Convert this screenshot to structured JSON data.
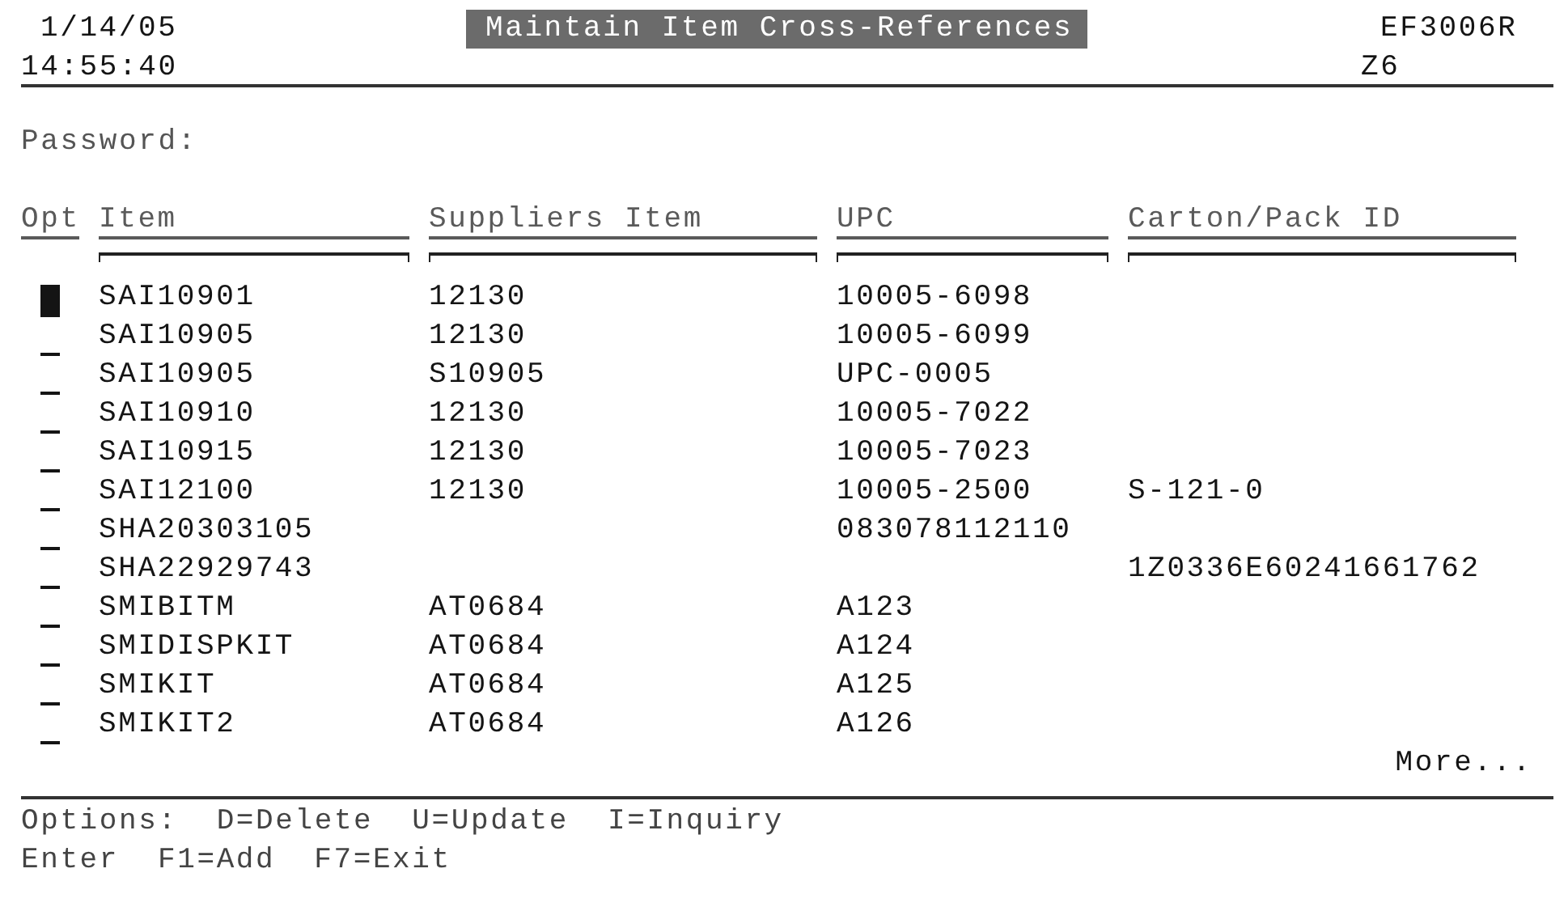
{
  "header": {
    "date": "1/14/05",
    "time": "14:55:40",
    "title": "Maintain Item Cross-References",
    "program": "EF3006R",
    "system": "Z6"
  },
  "password": {
    "label": "Password:"
  },
  "columns": [
    {
      "label": "Opt",
      "filter": false
    },
    {
      "label": "Item",
      "filter": true
    },
    {
      "label": "Suppliers Item",
      "filter": true
    },
    {
      "label": "UPC",
      "filter": true
    },
    {
      "label": "Carton/Pack ID",
      "filter": true
    }
  ],
  "rows": [
    {
      "cursor": true,
      "cells": [
        "SAI10901",
        "12130",
        "10005-6098",
        ""
      ]
    },
    {
      "cursor": false,
      "cells": [
        "SAI10905",
        "12130",
        "10005-6099",
        ""
      ]
    },
    {
      "cursor": false,
      "cells": [
        "SAI10905",
        "S10905",
        "UPC-0005",
        ""
      ]
    },
    {
      "cursor": false,
      "cells": [
        "SAI10910",
        "12130",
        "10005-7022",
        ""
      ]
    },
    {
      "cursor": false,
      "cells": [
        "SAI10915",
        "12130",
        "10005-7023",
        ""
      ]
    },
    {
      "cursor": false,
      "cells": [
        "SAI12100",
        "12130",
        "10005-2500",
        "S-121-0"
      ]
    },
    {
      "cursor": false,
      "cells": [
        "SHA20303105",
        "",
        "083078112110",
        ""
      ]
    },
    {
      "cursor": false,
      "cells": [
        "SHA22929743",
        "",
        "",
        "1Z0336E60241661762"
      ]
    },
    {
      "cursor": false,
      "cells": [
        "SMIBITM",
        "AT0684",
        "A123",
        ""
      ]
    },
    {
      "cursor": false,
      "cells": [
        "SMIDISPKIT",
        "AT0684",
        "A124",
        ""
      ]
    },
    {
      "cursor": false,
      "cells": [
        "SMIKIT",
        "AT0684",
        "A125",
        ""
      ]
    },
    {
      "cursor": false,
      "cells": [
        "SMIKIT2",
        "AT0684",
        "A126",
        ""
      ]
    }
  ],
  "more": "More...",
  "options": {
    "label": "Options:",
    "items": [
      "D=Delete",
      "U=Update",
      "I=Inquiry"
    ]
  },
  "keys": {
    "label": "Enter",
    "items": [
      "F1=Add",
      "F7=Exit"
    ]
  }
}
